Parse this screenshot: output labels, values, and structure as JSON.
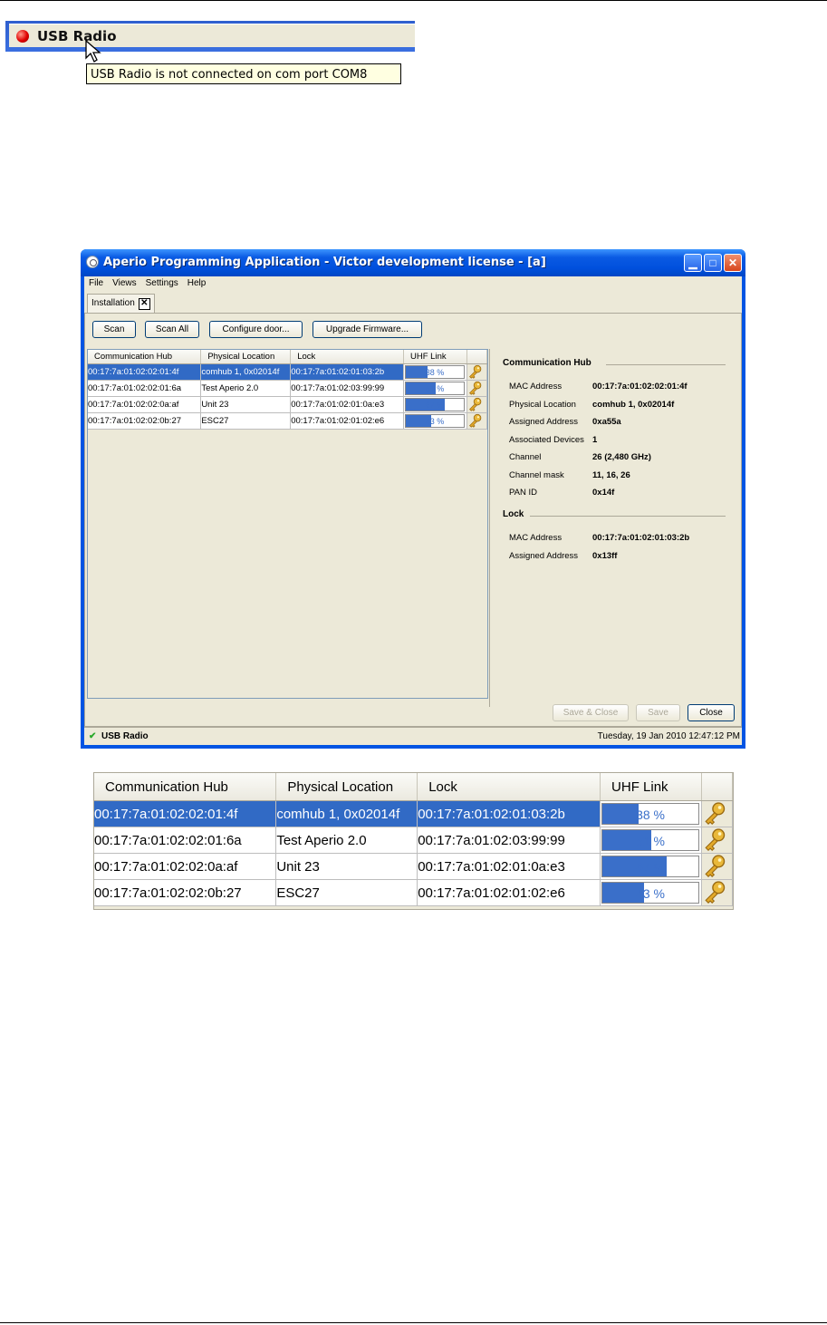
{
  "status_snippet": {
    "label": "USB Radio",
    "tooltip": "USB Radio is not connected on com port COM8"
  },
  "window": {
    "title": "Aperio Programming Application - Victor development license - [a]",
    "menu": [
      "File",
      "Views",
      "Settings",
      "Help"
    ],
    "tab": "Installation",
    "buttons": [
      "Scan",
      "Scan All",
      "Configure door...",
      "Upgrade Firmware..."
    ],
    "footer_buttons": [
      "Save & Close",
      "Save",
      "Close"
    ],
    "status_label": "USB Radio",
    "status_date": "Tuesday, 19 Jan 2010 12:47:12 PM"
  },
  "table": {
    "columns": [
      "Communication Hub",
      "Physical Location",
      "Lock",
      "UHF Link",
      ""
    ],
    "rows": [
      {
        "hub": "00:17:7a:01:02:02:01:4f",
        "location": "comhub 1, 0x02014f",
        "lock": "00:17:7a:01:02:01:03:2b",
        "link": 38,
        "link_label": "38 %",
        "selected": true
      },
      {
        "hub": "00:17:7a:01:02:02:01:6a",
        "location": "Test Aperio 2.0",
        "lock": "00:17:7a:01:02:03:99:99",
        "link": 51,
        "link_label": "51 %",
        "selected": false
      },
      {
        "hub": "00:17:7a:01:02:02:0a:af",
        "location": "Unit 23",
        "lock": "00:17:7a:01:02:01:0a:e3",
        "link": 67,
        "link_label": "67 %",
        "selected": false
      },
      {
        "hub": "00:17:7a:01:02:02:0b:27",
        "location": "ESC27",
        "lock": "00:17:7a:01:02:01:02:e6",
        "link": 43,
        "link_label": "43 %",
        "selected": false
      }
    ]
  },
  "details": {
    "hub_title": "Communication Hub",
    "hub_fields": [
      {
        "k": "MAC Address",
        "v": "00:17:7a:01:02:02:01:4f"
      },
      {
        "k": "Physical Location",
        "v": "comhub 1, 0x02014f"
      },
      {
        "k": "Assigned Address",
        "v": "0xa55a"
      },
      {
        "k": "Associated Devices",
        "v": "1"
      },
      {
        "k": "Channel",
        "v": "26 (2,480 GHz)"
      },
      {
        "k": "Channel mask",
        "v": "11, 16, 26"
      },
      {
        "k": "PAN ID",
        "v": "0x14f"
      }
    ],
    "lock_title": "Lock",
    "lock_fields": [
      {
        "k": "MAC Address",
        "v": "00:17:7a:01:02:01:03:2b"
      },
      {
        "k": "Assigned Address",
        "v": "0x13ff"
      }
    ]
  }
}
